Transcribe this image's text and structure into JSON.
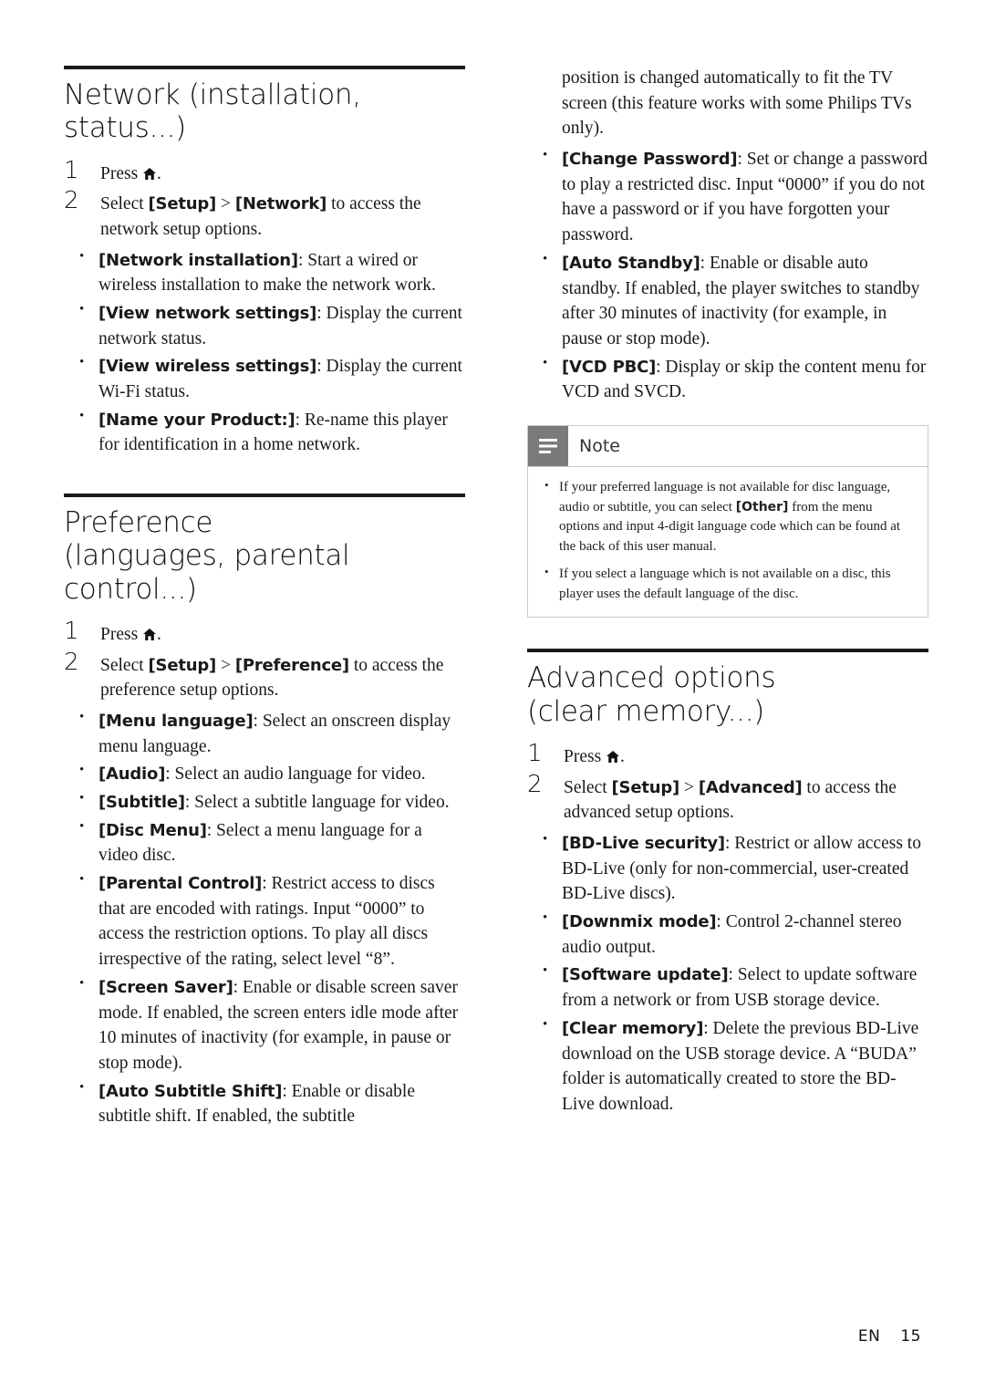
{
  "page": {
    "footer_label": "EN",
    "page_number": "15"
  },
  "left_column": {
    "section1": {
      "title_line1": "Network (installation,",
      "title_line2": "status...)",
      "steps": [
        {
          "num": "1",
          "text_before": "Press ",
          "icon": "home-icon",
          "text_after": "."
        },
        {
          "num": "2",
          "text": "Select [Setup] > [Network] to access the network setup options.",
          "bold_parts": [
            "[Setup]",
            "[Network]"
          ]
        }
      ],
      "bullets": [
        {
          "term": "[Network installation]",
          "desc": ": Start a wired or wireless installation to make the network work."
        },
        {
          "term": "[View network settings]",
          "desc": ": Display the current network status."
        },
        {
          "term": "[View wireless settings]",
          "desc": ": Display the current Wi-Fi status."
        },
        {
          "term": "[Name your Product:]",
          "desc": ": Re-name this player for identification in a home network."
        }
      ]
    },
    "section2": {
      "title_line1": "Preference",
      "title_line2": "(languages, parental control...)",
      "steps": [
        {
          "num": "1",
          "text_before": "Press ",
          "icon": "home-icon",
          "text_after": "."
        },
        {
          "num": "2",
          "text": "Select [Setup] > [Preference] to access the preference setup options."
        }
      ],
      "bullets": [
        {
          "term": "[Menu language]",
          "desc": ": Select an onscreen display menu language."
        },
        {
          "term": "[Audio]",
          "desc": ": Select an audio language for video."
        },
        {
          "term": "[Subtitle]",
          "desc": ": Select a subtitle language for video."
        },
        {
          "term": "[Disc Menu]",
          "desc": ": Select a menu language for a video disc."
        },
        {
          "term": "[Parental Control]",
          "desc": ": Restrict access to discs that are encoded with ratings. Input “0000” to access the restriction options. To play all discs irrespective of the rating, select level “8”."
        },
        {
          "term": "[Screen Saver]",
          "desc": ": Enable or disable screen saver mode. If enabled, the screen enters idle mode after 10 minutes of inactivity (for example, in pause or stop mode)."
        },
        {
          "term": "[Auto Subtitle Shift]",
          "desc": ": Enable or disable subtitle shift. If enabled, the subtitle"
        }
      ]
    }
  },
  "right_column": {
    "continuation_text": "position is changed automatically to fit the TV screen (this feature works with some Philips TVs only).",
    "bullets_top": [
      {
        "term": "[Change Password]",
        "desc": ": Set or change a password to play a restricted disc. Input “0000” if you do not have a password or if you have forgotten your password."
      },
      {
        "term": "[Auto Standby]",
        "desc": ": Enable or disable auto standby. If enabled, the player switches to standby after 30 minutes of inactivity (for example, in pause or stop mode)."
      },
      {
        "term": "[VCD PBC]",
        "desc": ": Display or skip the content menu for VCD and SVCD."
      }
    ],
    "note": {
      "title": "Note",
      "items": [
        {
          "text_1": "If your preferred language is not available for disc language, audio or subtitle, you can select ",
          "bold": "[Other]",
          "text_2": " from the menu options and input 4-digit language code which can be found at the back of this user manual."
        },
        {
          "text_1": "If you select a language which is not available on a disc, this player uses the default language of the disc.",
          "bold": "",
          "text_2": ""
        }
      ]
    },
    "section3": {
      "title_line1": "Advanced options",
      "title_line2": "(clear memory...)",
      "steps": [
        {
          "num": "1",
          "text_before": "Press ",
          "icon": "home-icon",
          "text_after": "."
        },
        {
          "num": "2",
          "text": "Select [Setup] > [Advanced] to access the advanced setup options."
        }
      ],
      "bullets": [
        {
          "term": "[BD-Live security]",
          "desc": ": Restrict or allow access to BD-Live (only for non-commercial, user-created BD-Live discs)."
        },
        {
          "term": "[Downmix mode]",
          "desc": ": Control 2-channel stereo audio output."
        },
        {
          "term": "[Software update]",
          "desc": ": Select to update software from a network or from USB storage device."
        },
        {
          "term": "[Clear memory]",
          "desc": ": Delete the previous BD-Live download on the USB storage device. A “BUDA” folder is automatically created to store the BD-Live download."
        }
      ]
    }
  }
}
